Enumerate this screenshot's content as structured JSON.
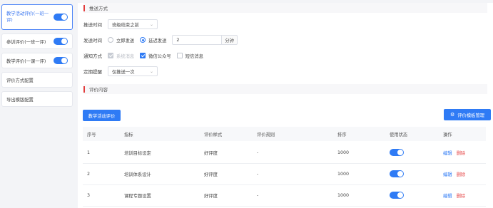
{
  "sidebar": {
    "items": [
      {
        "label": "教学活动评价(一班一评)",
        "toggle": true,
        "active": true
      },
      {
        "label": "参训评价(一班一评)",
        "toggle": true,
        "active": false
      },
      {
        "label": "教学评价(一课一评)",
        "toggle": true,
        "active": false
      },
      {
        "label": "评价方式配置",
        "toggle": false,
        "active": false
      },
      {
        "label": "导出模版配置",
        "toggle": false,
        "active": false
      }
    ]
  },
  "push": {
    "section_title": "推送方式",
    "push_time_label": "推送时间",
    "push_time_value": "班级结束之前",
    "send_time_label": "发送时间",
    "send_now_label": "立即发送",
    "send_delay_label": "延迟发送",
    "delay_value": "2",
    "delay_unit": "分钟",
    "notify_label": "通知方式",
    "notify_system": "系统消息",
    "notify_wechat": "微信公众号",
    "notify_sms": "短信消息",
    "remind_label": "定期提醒",
    "remind_value": "仅推送一次"
  },
  "content": {
    "section_title": "评价内容",
    "add_button": "教学活动评价",
    "template_button": "评价模板管理",
    "columns": [
      "序号",
      "指标",
      "评价样式",
      "评价规则",
      "排序",
      "使用状态",
      "操作"
    ],
    "rows": [
      {
        "index": "1",
        "indicator": "培训目标设定",
        "style": "好评度",
        "rule": "-",
        "order": "1000",
        "enabled": true,
        "edit": "编辑",
        "del": "删除"
      },
      {
        "index": "2",
        "indicator": "培训体系设计",
        "style": "好评度",
        "rule": "-",
        "order": "1000",
        "enabled": true,
        "edit": "编辑",
        "del": "删除"
      },
      {
        "index": "3",
        "indicator": "课程专题设置",
        "style": "好评度",
        "rule": "-",
        "order": "1000",
        "enabled": true,
        "edit": "编辑",
        "del": "删除"
      }
    ]
  },
  "colors": {
    "accent": "#2f7bf5",
    "danger": "#e64a4a",
    "section_bar": "#e23c3c"
  }
}
